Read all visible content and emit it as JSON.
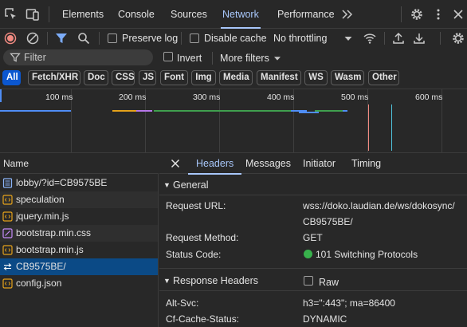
{
  "main_tabs": [
    {
      "label": "Elements"
    },
    {
      "label": "Console"
    },
    {
      "label": "Sources"
    },
    {
      "label": "Network",
      "active": true
    },
    {
      "label": "Performance"
    }
  ],
  "toolbar": {
    "preserve_log": "Preserve log",
    "disable_cache": "Disable cache",
    "throttling": "No throttling"
  },
  "filter": {
    "placeholder": "Filter",
    "invert": "Invert",
    "more_filters": "More filters"
  },
  "type_filters": [
    {
      "label": "All",
      "active": true
    },
    {
      "label": "Fetch/XHR"
    },
    {
      "label": "Doc"
    },
    {
      "label": "CSS"
    },
    {
      "label": "JS"
    },
    {
      "label": "Font"
    },
    {
      "label": "Img"
    },
    {
      "label": "Media"
    },
    {
      "label": "Manifest"
    },
    {
      "label": "WS"
    },
    {
      "label": "Wasm"
    },
    {
      "label": "Other"
    }
  ],
  "timeline": {
    "ticks": [
      "100 ms",
      "200 ms",
      "300 ms",
      "400 ms",
      "500 ms",
      "600 ms"
    ],
    "colors": {
      "blue": "#4f8df5",
      "orange": "#e5a21a",
      "purple": "#b676e8",
      "green": "#3f9f4e",
      "red": "#f28b82",
      "cyan": "#4fc3dc"
    }
  },
  "request_list": {
    "header": "Name",
    "items": [
      {
        "name": "lobby/?id=CB9575BE",
        "icon": "document-icon"
      },
      {
        "name": "speculation",
        "icon": "script-icon"
      },
      {
        "name": "jquery.min.js",
        "icon": "script-icon"
      },
      {
        "name": "bootstrap.min.css",
        "icon": "stylesheet-icon"
      },
      {
        "name": "bootstrap.min.js",
        "icon": "script-icon"
      },
      {
        "name": "CB9575BE/",
        "icon": "websocket-icon",
        "selected": true
      },
      {
        "name": "config.json",
        "icon": "script-icon"
      }
    ]
  },
  "details": {
    "tabs": [
      {
        "label": "Headers",
        "active": true
      },
      {
        "label": "Messages"
      },
      {
        "label": "Initiator"
      },
      {
        "label": "Timing"
      }
    ],
    "general": {
      "title": "General",
      "request_url_label": "Request URL:",
      "request_url_line1": "wss://doko.laudian.de/ws/dokosync/",
      "request_url_line2": "CB9575BE/",
      "request_method_label": "Request Method:",
      "request_method": "GET",
      "status_code_label": "Status Code:",
      "status_code": "101 Switching Protocols",
      "status_color": "#38b24c"
    },
    "response_headers": {
      "title": "Response Headers",
      "raw_label": "Raw",
      "rows": [
        {
          "key": "Alt-Svc:",
          "value": "h3=\":443\"; ma=86400"
        },
        {
          "key": "Cf-Cache-Status:",
          "value": "DYNAMIC"
        }
      ]
    }
  }
}
